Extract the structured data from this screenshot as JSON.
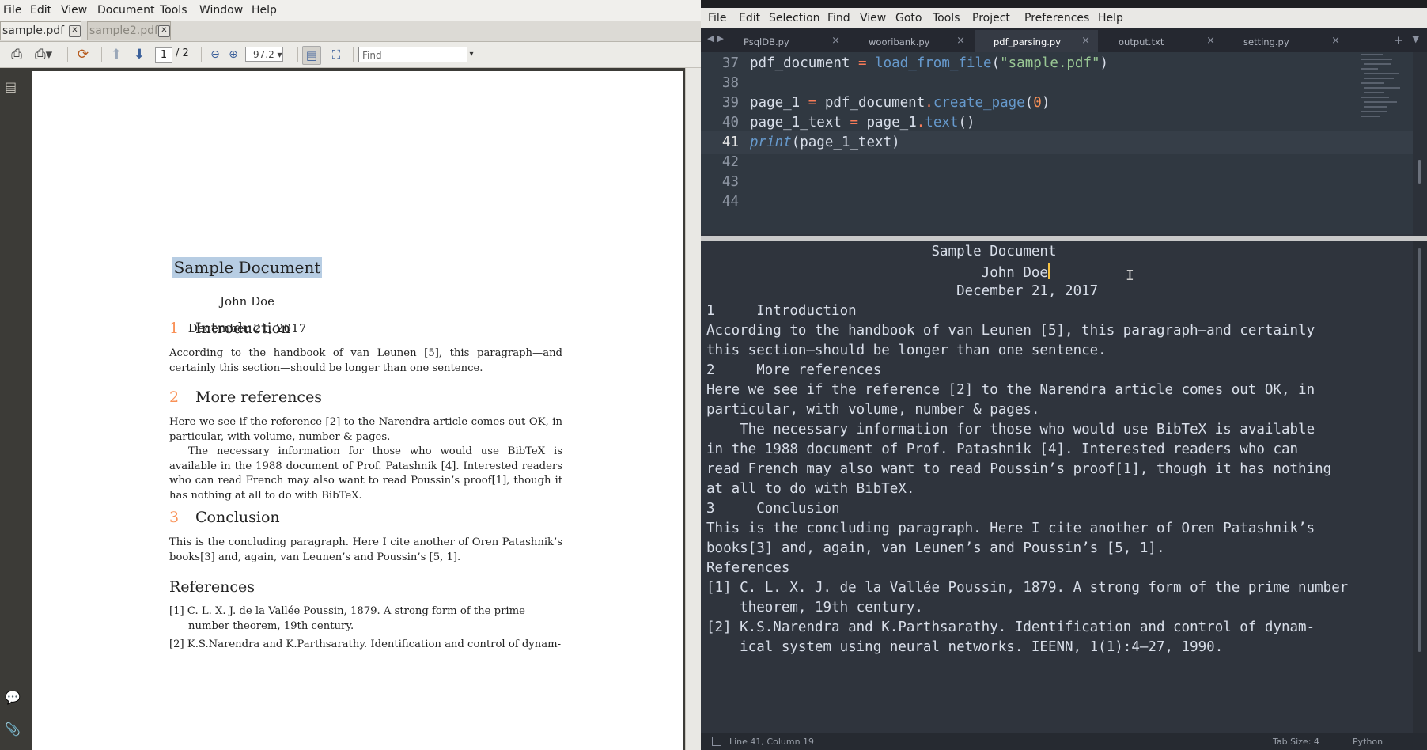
{
  "pdf_viewer": {
    "menu": [
      "File",
      "Edit",
      "View",
      "Document",
      "Tools",
      "Window",
      "Help"
    ],
    "tabs": [
      {
        "label": "sample.pdf",
        "active": true
      },
      {
        "label": "sample2.pdf",
        "active": false
      }
    ],
    "toolbar": {
      "page_current": "1",
      "page_total": "/ 2",
      "zoom": "97.2",
      "find_placeholder": "Find",
      "icons": [
        "print-icon",
        "print-options-icon",
        "rotate-icon",
        "page-up-icon",
        "page-down-icon",
        "zoom-out-icon",
        "zoom-in-icon",
        "fit-page-icon",
        "fit-width-icon"
      ]
    },
    "document": {
      "title": "Sample Document",
      "author": "John Doe",
      "date": "December 21, 2017",
      "s1_num": "1",
      "s1_title": "Introduction",
      "s1_p": "According to the handbook of van Leunen [5], this paragraph—and certainly this section—should be longer than one sentence.",
      "s2_num": "2",
      "s2_title": "More references",
      "s2_p1": "Here we see if the reference [2] to the Narendra article comes out OK, in particular, with volume, number & pages.",
      "s2_p2": "The necessary information for those who would use BibTeX is available in the 1988 document of Prof. Patashnik [4]. Interested readers who can read French may also want to read Poussin’s proof[1], though it has nothing at all to do with BibTeX.",
      "s3_num": "3",
      "s3_title": "Conclusion",
      "s3_p": "This is the concluding paragraph. Here I cite another of Oren Patashnik’s books[3] and, again, van Leunen’s and Poussin’s [5, 1].",
      "refs_title": "References",
      "ref1": "[1]  C. L. X. J. de la Vallée Poussin, 1879. A strong form of the prime number theorem, 19th century.",
      "ref2": "[2]  K.S.Narendra and K.Parthsarathy. Identification and control of dynam-"
    }
  },
  "editor": {
    "menu": [
      "File",
      "Edit",
      "Selection",
      "Find",
      "View",
      "Goto",
      "Tools",
      "Project",
      "Preferences",
      "Help"
    ],
    "tabs": [
      {
        "label": "PsqlDB.py",
        "active": false
      },
      {
        "label": "wooribank.py",
        "active": false
      },
      {
        "label": "pdf_parsing.py",
        "active": true
      },
      {
        "label": "output.txt",
        "active": false
      },
      {
        "label": "setting.py",
        "active": false
      }
    ],
    "line_numbers": [
      "37",
      "38",
      "39",
      "40",
      "41",
      "42",
      "43",
      "44"
    ],
    "code": {
      "l37_var": "pdf_document",
      "l37_op": " = ",
      "l37_fn": "load_from_file",
      "l37_p1": "(",
      "l37_str": "\"sample.pdf\"",
      "l37_p2": ")",
      "l39_var": "page_1",
      "l39_op": " = ",
      "l39_obj": "pdf_document",
      "l39_dot": ".",
      "l39_fn": "create_page",
      "l39_p1": "(",
      "l39_num": "0",
      "l39_p2": ")",
      "l40_var": "page_1_text",
      "l40_op": " = ",
      "l40_obj": "page_1",
      "l40_dot": ".",
      "l40_fn": "text",
      "l40_p": "()",
      "l41_kw": "print",
      "l41_rest": "(page_1_text)"
    },
    "output_lines": [
      "                           Sample Document",
      "                                 John Doe",
      "                              December 21, 2017",
      "1     Introduction",
      "According to the handbook of van Leunen [5], this paragraph—and certainly",
      "this section—should be longer than one sentence.",
      "2     More references",
      "Here we see if the reference [2] to the Narendra article comes out OK, in",
      "particular, with volume, number & pages.",
      "    The necessary information for those who would use BibTeX is available",
      "in the 1988 document of Prof. Patashnik [4]. Interested readers who can",
      "read French may also want to read Poussin’s proof[1], though it has nothing",
      "at all to do with BibTeX.",
      "3     Conclusion",
      "This is the concluding paragraph. Here I cite another of Oren Patashnik’s",
      "books[3] and, again, van Leunen’s and Poussin’s [5, 1].",
      "References",
      "[1] C. L. X. J. de la Vallée Poussin, 1879. A strong form of the prime number",
      "    theorem, 19th century.",
      "[2] K.S.Narendra and K.Parthsarathy. Identification and control of dynam-",
      "    ical system using neural networks. IEENN, 1(1):4–27, 1990."
    ],
    "status": {
      "position": "Line 41, Column 19",
      "tab_size": "Tab Size: 4",
      "syntax": "Python"
    }
  }
}
